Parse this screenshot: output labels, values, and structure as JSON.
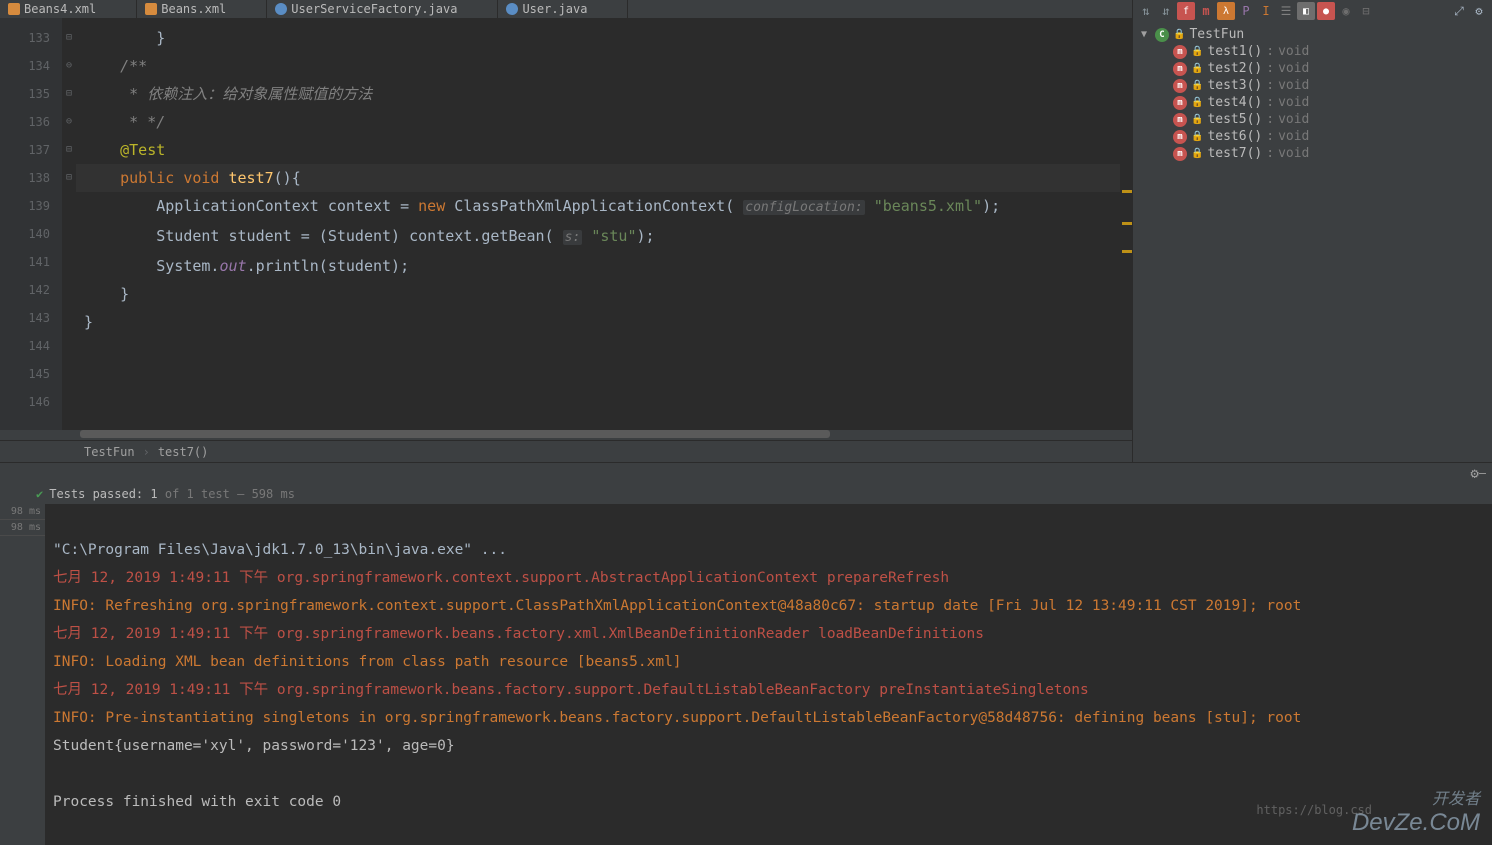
{
  "tabs": [
    {
      "name": "Beans4.xml",
      "type": "xml"
    },
    {
      "name": "Beans.xml",
      "type": "xml"
    },
    {
      "name": "UserServiceFactory.java",
      "type": "java"
    },
    {
      "name": "User.java",
      "type": "java"
    }
  ],
  "gutter": [
    "133",
    "134",
    "135",
    "136",
    "137",
    "138",
    "139",
    "140",
    "141",
    "142",
    "143",
    "144",
    "145",
    "146"
  ],
  "code": {
    "l133": "        }",
    "l135": "    /**",
    "l136": "     * 依赖注入：给对象属性赋值的方法",
    "l137": "     * */",
    "l138_ann": "    @Test",
    "l139_kw1": "    public",
    "l139_kw2": "void",
    "l139_fn": "test7",
    "l139_tail": "(){",
    "l140_a": "        ApplicationContext context = ",
    "l140_new": "new",
    "l140_b": " ClassPathXmlApplicationContext( ",
    "l140_hint": "configLocation:",
    "l140_str": "\"beans5.xml\"",
    "l140_tail": ");",
    "l141_a": "        Student student = (Student) context.getBean( ",
    "l141_hint": "s:",
    "l141_str": "\"stu\"",
    "l141_tail": ");",
    "l142_a": "        System.",
    "l142_out": "out",
    "l142_b": ".println(student);",
    "l143": "    }",
    "l145": "}"
  },
  "breadcrumb": {
    "class": "TestFun",
    "method": "test7()"
  },
  "structure": {
    "class_name": "TestFun",
    "methods": [
      {
        "name": "test1()",
        "ret": "void"
      },
      {
        "name": "test2()",
        "ret": "void"
      },
      {
        "name": "test3()",
        "ret": "void"
      },
      {
        "name": "test4()",
        "ret": "void"
      },
      {
        "name": "test5()",
        "ret": "void"
      },
      {
        "name": "test6()",
        "ret": "void"
      },
      {
        "name": "test7()",
        "ret": "void"
      }
    ]
  },
  "tests": {
    "label_a": "Tests passed:",
    "count": "1",
    "of": "of 1 test",
    "time": "– 598 ms"
  },
  "run_side": [
    "98 ms",
    "98 ms"
  ],
  "console": {
    "l1": "\"C:\\Program Files\\Java\\jdk1.7.0_13\\bin\\java.exe\" ...",
    "l2": "七月 12, 2019 1:49:11 下午 org.springframework.context.support.AbstractApplicationContext prepareRefresh",
    "l3": "INFO: Refreshing org.springframework.context.support.ClassPathXmlApplicationContext@48a80c67: startup date [Fri Jul 12 13:49:11 CST 2019]; root ",
    "l4": "七月 12, 2019 1:49:11 下午 org.springframework.beans.factory.xml.XmlBeanDefinitionReader loadBeanDefinitions",
    "l5": "INFO: Loading XML bean definitions from class path resource [beans5.xml]",
    "l6": "七月 12, 2019 1:49:11 下午 org.springframework.beans.factory.support.DefaultListableBeanFactory preInstantiateSingletons",
    "l7": "INFO: Pre-instantiating singletons in org.springframework.beans.factory.support.DefaultListableBeanFactory@58d48756: defining beans [stu]; root ",
    "l8": "Student{username='xyl', password='123', age=0}",
    "l9": "",
    "l10": "Process finished with exit code 0"
  },
  "watermark_main": "DevZe.CoM",
  "watermark_sub": "开发者",
  "watermark_url": "https://blog.csd"
}
